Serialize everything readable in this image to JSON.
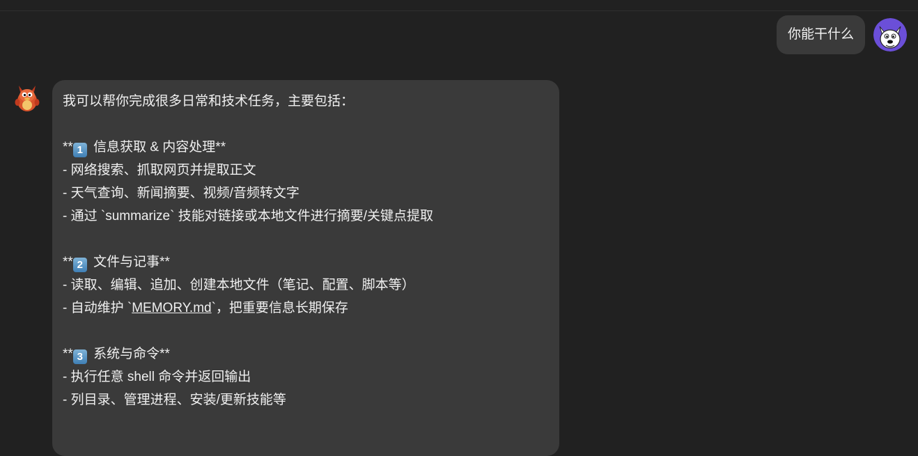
{
  "user_message": {
    "text": "你能干什么"
  },
  "assistant_message": {
    "intro": "我可以帮你完成很多日常和技术任务，主要包括：",
    "sections": [
      {
        "prefix": "**",
        "number": "1",
        "title": " 信息获取 & 内容处理**",
        "items": [
          "- 网络搜索、抓取网页并提取正文",
          "- 天气查询、新闻摘要、视频/音频转文字",
          "- 通过 `summarize` 技能对链接或本地文件进行摘要/关键点提取"
        ]
      },
      {
        "prefix": "**",
        "number": "2",
        "title": " 文件与记事**",
        "items": [
          "- 读取、编辑、追加、创建本地文件（笔记、配置、脚本等）"
        ],
        "memory_line": {
          "before": "- 自动维护 `",
          "link": "MEMORY.md",
          "after": "`，把重要信息长期保存"
        }
      },
      {
        "prefix": "**",
        "number": "3",
        "title": " 系统与命令**",
        "items": [
          "- 执行任意 shell 命令并返回输出",
          "- 列目录、管理进程、安装/更新技能等"
        ]
      }
    ]
  },
  "icons": {
    "user_avatar": "dog-avatar-icon",
    "assistant_avatar": "mascot-avatar-icon",
    "keycap": "keycap-number-emoji"
  }
}
